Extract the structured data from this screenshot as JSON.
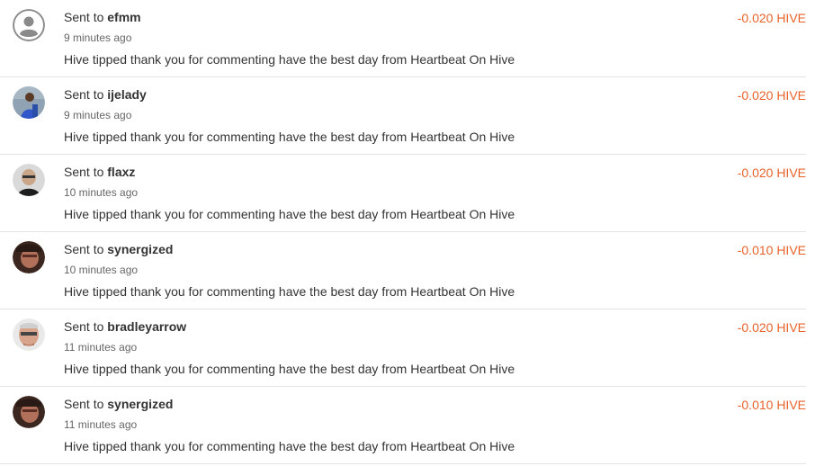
{
  "transactions": [
    {
      "prefix": "Sent to ",
      "user": "efmm",
      "time": "9 minutes ago",
      "memo": "Hive tipped thank you for commenting have the best day from Heartbeat On Hive",
      "amount": "-0.020 HIVE",
      "avatar": "default-user-icon"
    },
    {
      "prefix": "Sent to ",
      "user": "ijelady",
      "time": "9 minutes ago",
      "memo": "Hive tipped thank you for commenting have the best day from Heartbeat On Hive",
      "amount": "-0.020 HIVE",
      "avatar": "photo"
    },
    {
      "prefix": "Sent to ",
      "user": "flaxz",
      "time": "10 minutes ago",
      "memo": "Hive tipped thank you for commenting have the best day from Heartbeat On Hive",
      "amount": "-0.020 HIVE",
      "avatar": "photo"
    },
    {
      "prefix": "Sent to ",
      "user": "synergized",
      "time": "10 minutes ago",
      "memo": "Hive tipped thank you for commenting have the best day from Heartbeat On Hive",
      "amount": "-0.010 HIVE",
      "avatar": "photo"
    },
    {
      "prefix": "Sent to ",
      "user": "bradleyarrow",
      "time": "11 minutes ago",
      "memo": "Hive tipped thank you for commenting have the best day from Heartbeat On Hive",
      "amount": "-0.020 HIVE",
      "avatar": "photo"
    },
    {
      "prefix": "Sent to ",
      "user": "synergized",
      "time": "11 minutes ago",
      "memo": "Hive tipped thank you for commenting have the best day from Heartbeat On Hive",
      "amount": "-0.010 HIVE",
      "avatar": "photo"
    }
  ],
  "colors": {
    "amount": "#e8622a",
    "divider": "#e3e3e3",
    "text": "#333333",
    "muted": "#666666"
  }
}
